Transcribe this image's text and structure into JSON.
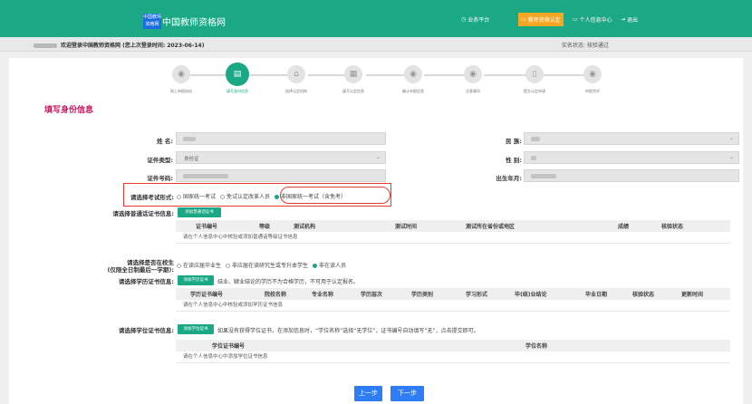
{
  "header": {
    "logo_text": "中国教师资格网",
    "site_name": "中国教师资格网",
    "nav": [
      {
        "label": "业务平台",
        "icon": "clock-icon"
      },
      {
        "label": "教师资格认定",
        "icon": "monitor-icon",
        "active": true
      },
      {
        "label": "个人信息中心",
        "icon": "monitor-icon"
      },
      {
        "label": "退出",
        "icon": "exit-icon"
      }
    ]
  },
  "welcome": {
    "text": "欢迎登录中国教师资格网 (您上次登录时间: 2023-06-14)",
    "status": "实名状态: 核验通过"
  },
  "steps": [
    {
      "label": "网上申报协议",
      "icon": "eye-icon"
    },
    {
      "label": "填写身份信息",
      "icon": "document-icon",
      "active": true
    },
    {
      "label": "选择认定机构",
      "icon": "building-icon"
    },
    {
      "label": "填写认定信息",
      "icon": "list-icon"
    },
    {
      "label": "确认申报信息",
      "icon": "eye-icon"
    },
    {
      "label": "注意事项",
      "icon": "eye-icon"
    },
    {
      "label": "提交认定申请",
      "icon": "file-icon"
    },
    {
      "label": "申报完毕",
      "icon": "eye-icon"
    }
  ],
  "section_title": "填写身份信息",
  "form": {
    "name_label": "姓 名:",
    "ethnic_label": "民 族:",
    "id_type_label": "证件类型:",
    "id_type_value": "身份证",
    "gender_label": "性 别:",
    "id_number_label": "证件号码:",
    "birth_label": "出生年月:",
    "exam_form_label": "请选择考试形式:",
    "exam_options": [
      "国家统一考试",
      "免试认定改革人员",
      "非国家统一考试（含免考）"
    ],
    "mandarin_label": "请选择普通话证书信息:",
    "add_mandarin_btn": "添加普通话证书",
    "mandarin_headers": [
      "证书编号",
      "等级",
      "测试机构",
      "测试时间",
      "测试所在省份或地区",
      "成绩",
      "核验状态"
    ],
    "mandarin_empty": "请在个人信息中心中核验或添加普通话等级证书信息",
    "school_label": "请选择是否在校生",
    "school_sublabel": "(仅限全日制最后一学期):",
    "school_options": [
      "在读应届毕业生",
      "非应届在读研究生或专升本学生",
      "非在读人员"
    ],
    "edu_label": "请选择学历证书信息:",
    "add_edu_btn": "添加学历证书",
    "edu_note": "结业、肄业结论的学历不为合格学历，不可用于认定报名。",
    "edu_headers": [
      "学历证书编号",
      "院校名称",
      "专业名称",
      "学历层次",
      "学历类别",
      "学习形式",
      "毕(结)业结论",
      "毕业日期",
      "核验状态",
      "更新时间"
    ],
    "edu_empty": "请在个人信息中心中核验或添加学历证书信息",
    "degree_label": "请选择学位证书信息:",
    "add_degree_btn": "添加学位证书",
    "degree_note": "如果没有获得学位证书，在添加信息时，“学位名称”选择“无学位”，证书编号自动填写“无”，点击提交即可。",
    "degree_headers": [
      "学位证书编号",
      "学位名称"
    ],
    "degree_empty": "请在个人信息中心中添加学位证书信息"
  },
  "buttons": {
    "prev": "上一步",
    "next": "下一步"
  }
}
